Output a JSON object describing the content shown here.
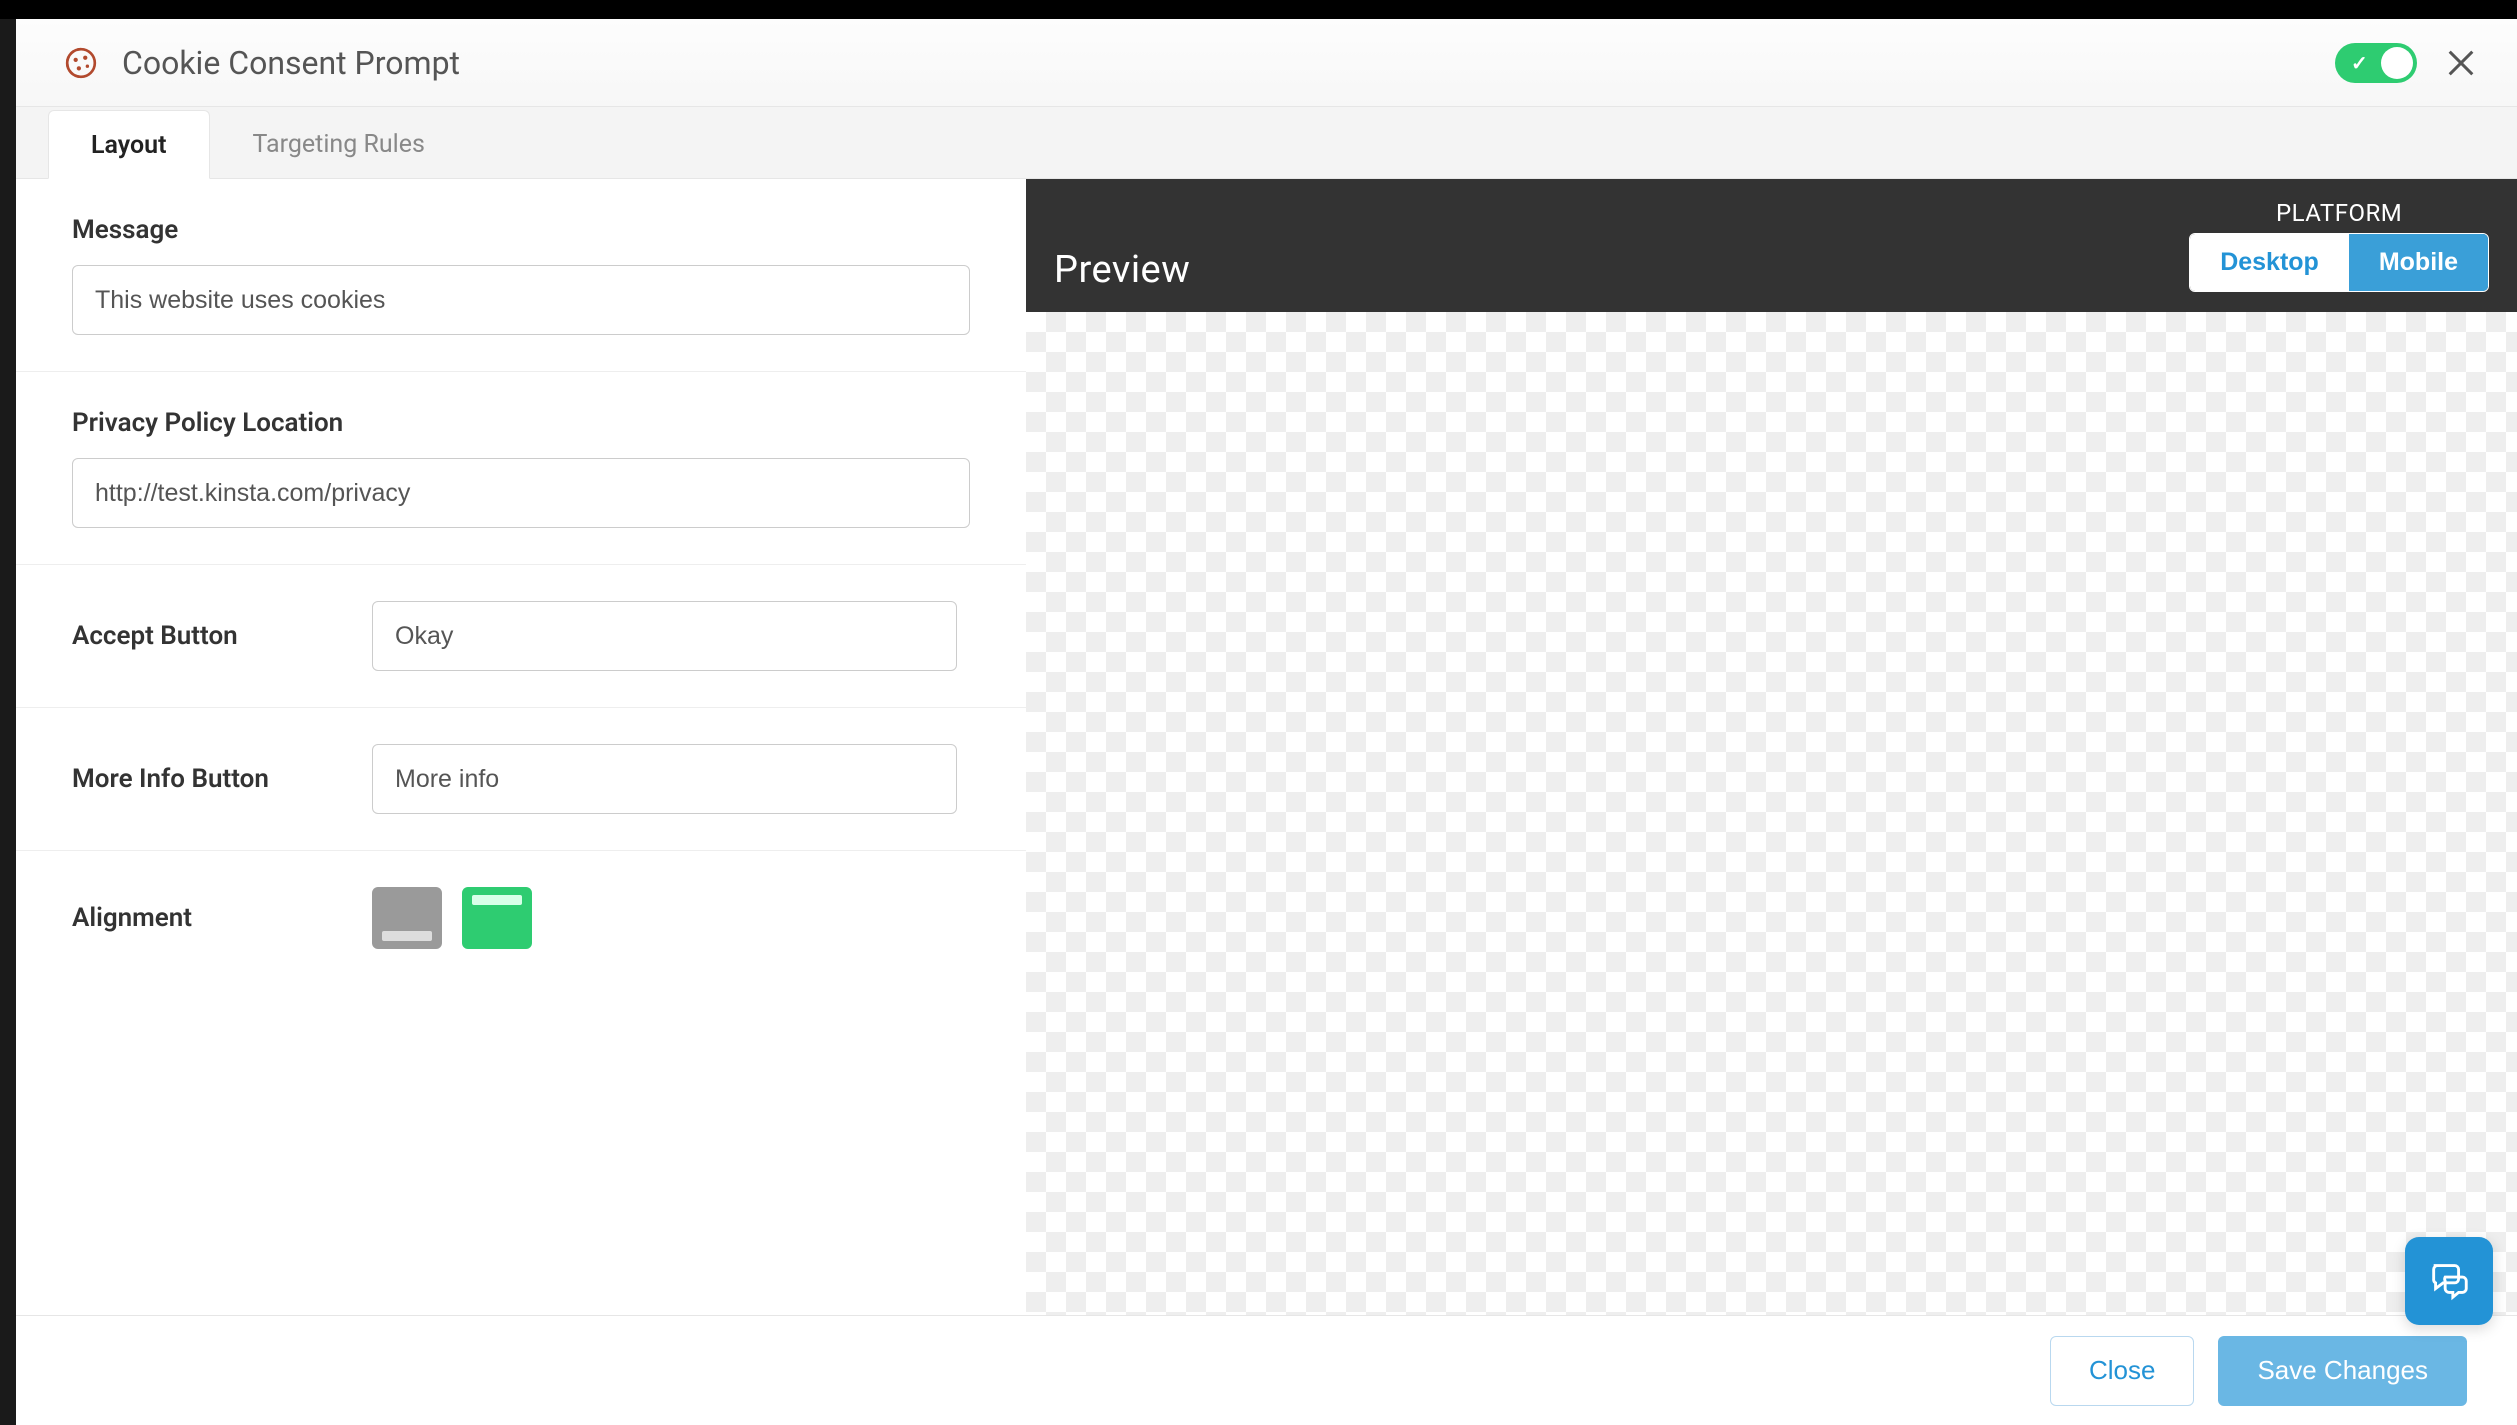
{
  "header": {
    "title": "Cookie Consent Prompt",
    "enabled": true
  },
  "tabs": {
    "layout": "Layout",
    "targeting": "Targeting Rules",
    "active": "layout"
  },
  "form": {
    "message_label": "Message",
    "message_value": "This website uses cookies",
    "privacy_label": "Privacy Policy Location",
    "privacy_value": "http://test.kinsta.com/privacy",
    "accept_label": "Accept Button",
    "accept_value": "Okay",
    "moreinfo_label": "More Info Button",
    "moreinfo_value": "More info",
    "alignment_label": "Alignment",
    "alignment_selected": "top"
  },
  "preview": {
    "title": "Preview",
    "platform_label": "PLATFORM",
    "desktop": "Desktop",
    "mobile": "Mobile",
    "platform_active": "mobile"
  },
  "footer": {
    "close": "Close",
    "save": "Save Changes"
  }
}
